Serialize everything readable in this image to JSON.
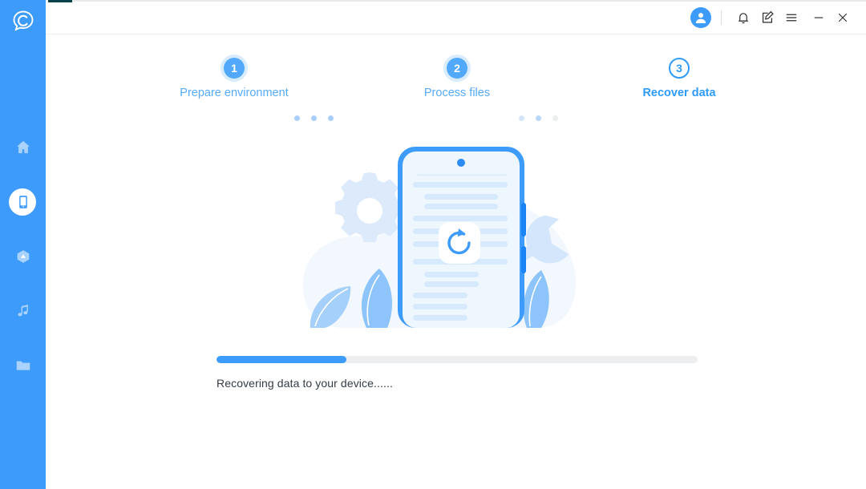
{
  "window": {
    "brand_color": "#3d9bfc",
    "accent_color": "#2e9bfb",
    "logo_icon": "chat-bubble-c-logo"
  },
  "titlebar": {
    "controls": [
      {
        "name": "account-avatar",
        "icon": "user-avatar-icon",
        "label": ""
      },
      {
        "name": "notifications-button",
        "icon": "bell-icon",
        "label": ""
      },
      {
        "name": "feedback-button",
        "icon": "note-edit-icon",
        "label": ""
      },
      {
        "name": "menu-button",
        "icon": "hamburger-menu-icon",
        "label": ""
      },
      {
        "name": "minimize-button",
        "icon": "minimize-icon",
        "label": ""
      },
      {
        "name": "close-button",
        "icon": "close-icon",
        "label": ""
      }
    ]
  },
  "sidebar": {
    "items": [
      {
        "name": "sidebar-item-home",
        "icon": "home-icon",
        "active": false
      },
      {
        "name": "sidebar-item-phone",
        "icon": "phone-icon",
        "active": true
      },
      {
        "name": "sidebar-item-cloud",
        "icon": "cloud-icon",
        "active": false
      },
      {
        "name": "sidebar-item-music",
        "icon": "music-note-icon",
        "active": false
      },
      {
        "name": "sidebar-item-files",
        "icon": "folder-icon",
        "active": false
      }
    ]
  },
  "stepper": {
    "steps": [
      {
        "number": "1",
        "label": "Prepare environment",
        "state": "done"
      },
      {
        "number": "2",
        "label": "Process files",
        "state": "done"
      },
      {
        "number": "3",
        "label": "Recover data",
        "state": "active"
      }
    ],
    "dot_colors_group1": [
      "#a8cffb",
      "#a8cffb",
      "#a8cffb"
    ],
    "dot_colors_group2": [
      "#d5e6fa",
      "#b9d8fb",
      "#ebedee"
    ]
  },
  "illustration": {
    "name": "phone-data-recovery-illustration",
    "center_icon": "refresh-restore-icon",
    "elements": [
      "gear-icon",
      "wrench-icon",
      "leaf-icon",
      "smartphone-icon"
    ]
  },
  "progress": {
    "percent": 27,
    "status_text": "Recovering data to your device......"
  }
}
